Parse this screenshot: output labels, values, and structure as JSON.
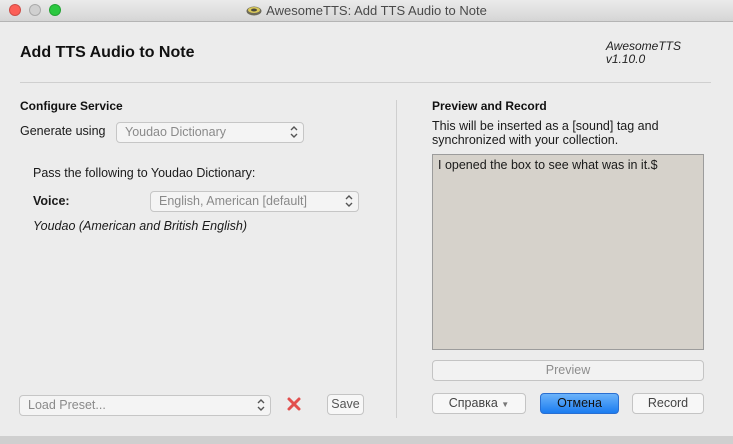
{
  "window": {
    "title": "AwesomeTTS: Add TTS Audio to Note",
    "header_title": "Add TTS Audio to Note",
    "brand_name": "AwesomeTTS",
    "brand_version": "v1.10.0"
  },
  "configure": {
    "section_title": "Configure Service",
    "generate_label": "Generate using",
    "service_value": "Youdao Dictionary",
    "pass_label": "Pass the following to Youdao Dictionary:",
    "voice_label": "Voice:",
    "voice_value": "English, American [default]",
    "service_note": "Youdao (American and British English)"
  },
  "preset": {
    "load_value": "Load Preset...",
    "save_label": "Save"
  },
  "preview": {
    "section_title": "Preview and Record",
    "description": "This will be inserted as a [sound] tag and synchronized with your collection.",
    "text_value": "I opened the box to see what was in it.$",
    "preview_label": "Preview"
  },
  "footer": {
    "help_label": "Справка",
    "cancel_label": "Отмена",
    "record_label": "Record"
  },
  "colors": {
    "close": "#fc5f57",
    "maximize": "#2bc840",
    "primary_button": "#1b7cf0",
    "delete_icon": "#e2504e"
  }
}
